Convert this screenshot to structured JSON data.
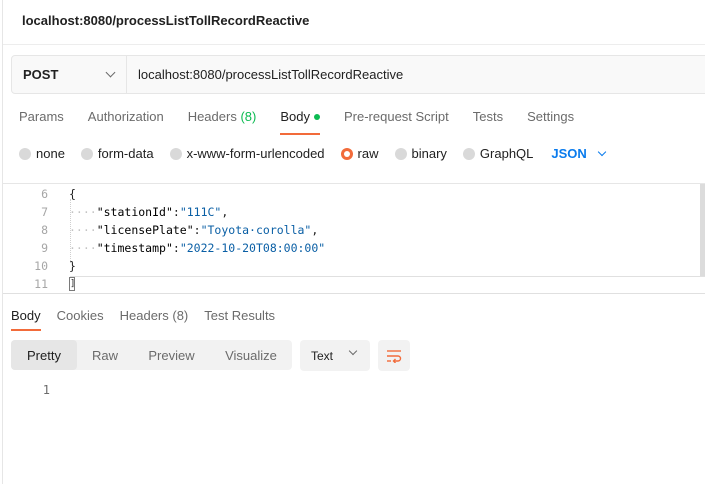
{
  "header": {
    "title": "localhost:8080/processListTollRecordReactive"
  },
  "request": {
    "method": "POST",
    "url": "localhost:8080/processListTollRecordReactive"
  },
  "request_tabs": {
    "params": "Params",
    "authorization": "Authorization",
    "headers": "Headers",
    "headers_count": "(8)",
    "body": "Body",
    "pre_request": "Pre-request Script",
    "tests": "Tests",
    "settings": "Settings"
  },
  "body_types": {
    "none": "none",
    "form_data": "form-data",
    "urlencoded": "x-www-form-urlencoded",
    "raw": "raw",
    "binary": "binary",
    "graphql": "GraphQL",
    "format": "JSON"
  },
  "editor": {
    "line_numbers": [
      "6",
      "7",
      "8",
      "9",
      "10",
      "11"
    ],
    "indent_dots": "····",
    "open_brace": "{",
    "close_brace": "}",
    "cursor_line": "]",
    "fields": [
      {
        "key": "\"stationId\"",
        "value": "\"111C\"",
        "sep": ":",
        "trail": ","
      },
      {
        "key": "\"licensePlate\"",
        "value": "\"Toyota·corolla\"",
        "sep": ":",
        "trail": ","
      },
      {
        "key": "\"timestamp\"",
        "value": "\"2022-10-20T08:00:00\"",
        "sep": ":",
        "trail": ""
      }
    ]
  },
  "response_tabs": {
    "body": "Body",
    "cookies": "Cookies",
    "headers": "Headers (8)",
    "test_results": "Test Results"
  },
  "response_view": {
    "pretty": "Pretty",
    "raw": "Raw",
    "preview": "Preview",
    "visualize": "Visualize",
    "text_format": "Text"
  },
  "response_body": {
    "line_number": "1"
  },
  "colors": {
    "accent_orange": "#f26b3a",
    "accent_green": "#0cbb52",
    "accent_blue": "#097bed"
  }
}
